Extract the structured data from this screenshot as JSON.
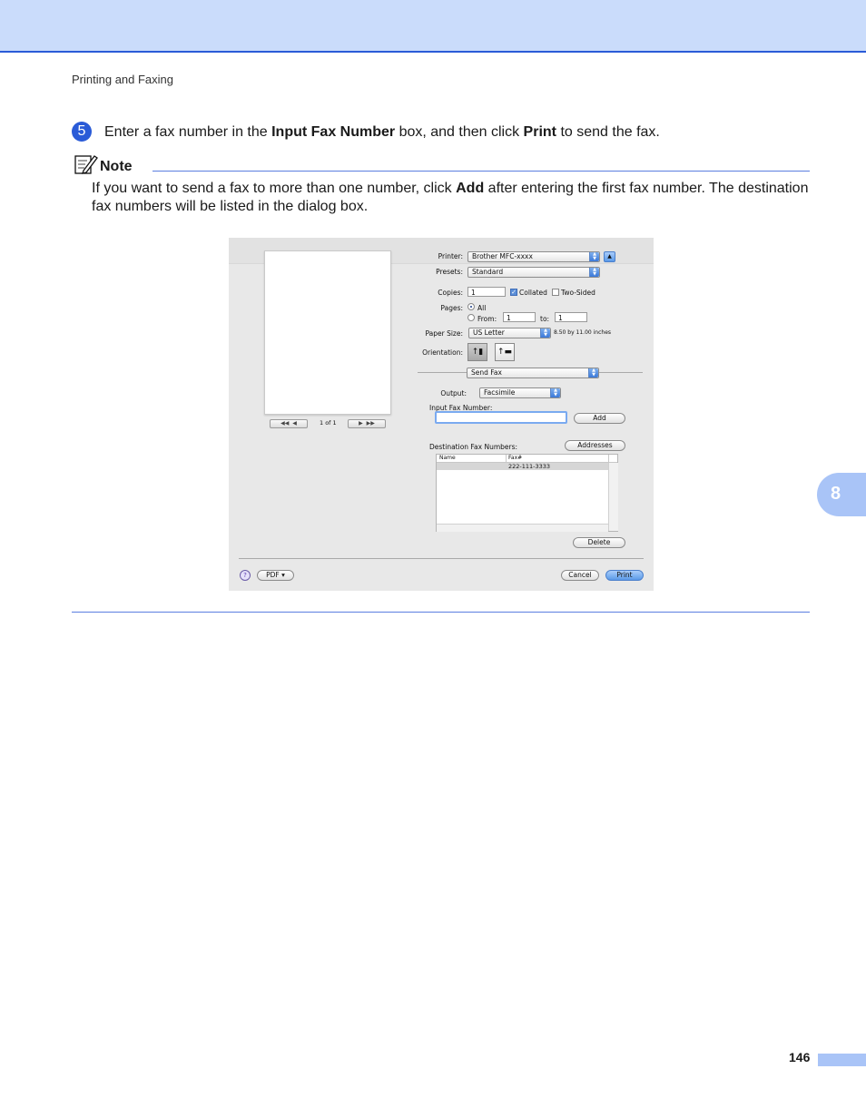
{
  "header": {
    "section": "Printing and Faxing"
  },
  "step": {
    "number": "5",
    "text_before": "Enter a fax number in the ",
    "bold1": "Input Fax Number",
    "text_middle": " box, and then click ",
    "bold2": "Print",
    "text_after": " to send the fax."
  },
  "note": {
    "label": "Note",
    "text_before": "If you want to send a fax to more than one number, click ",
    "bold": "Add",
    "text_after": " after entering the first fax number. The destination fax numbers will be listed in the dialog box."
  },
  "dialog": {
    "preview": {
      "first_label": "◀◀",
      "prev_label": "◀",
      "page_indicator": "1 of 1",
      "next_label": "▶",
      "last_label": "▶▶"
    },
    "printer": {
      "label": "Printer:",
      "value": "Brother MFC-xxxx"
    },
    "presets": {
      "label": "Presets:",
      "value": "Standard"
    },
    "copies": {
      "label": "Copies:",
      "value": "1",
      "collated_label": "Collated",
      "collated_checked": true,
      "two_sided_label": "Two-Sided",
      "two_sided_checked": false
    },
    "pages": {
      "label": "Pages:",
      "all_label": "All",
      "from_label": "From:",
      "from_value": "1",
      "to_label": "to:",
      "to_value": "1"
    },
    "paper_size": {
      "label": "Paper Size:",
      "value": "US Letter",
      "dimensions": "8.50 by 11.00 inches"
    },
    "orientation": {
      "label": "Orientation:"
    },
    "panel": {
      "value": "Send Fax"
    },
    "output": {
      "label": "Output:",
      "value": "Facsimile"
    },
    "input_fax": {
      "label": "Input Fax Number:",
      "value": "",
      "add_label": "Add"
    },
    "destination": {
      "label": "Destination Fax Numbers:",
      "addresses_label": "Addresses",
      "columns": [
        "Name",
        "Fax#"
      ],
      "rows": [
        {
          "name": "",
          "fax": "222-111-3333"
        }
      ],
      "delete_label": "Delete"
    },
    "footer": {
      "help": "?",
      "pdf_label": "PDF ▾",
      "cancel_label": "Cancel",
      "print_label": "Print"
    }
  },
  "chapter": "8",
  "page_number": "146"
}
